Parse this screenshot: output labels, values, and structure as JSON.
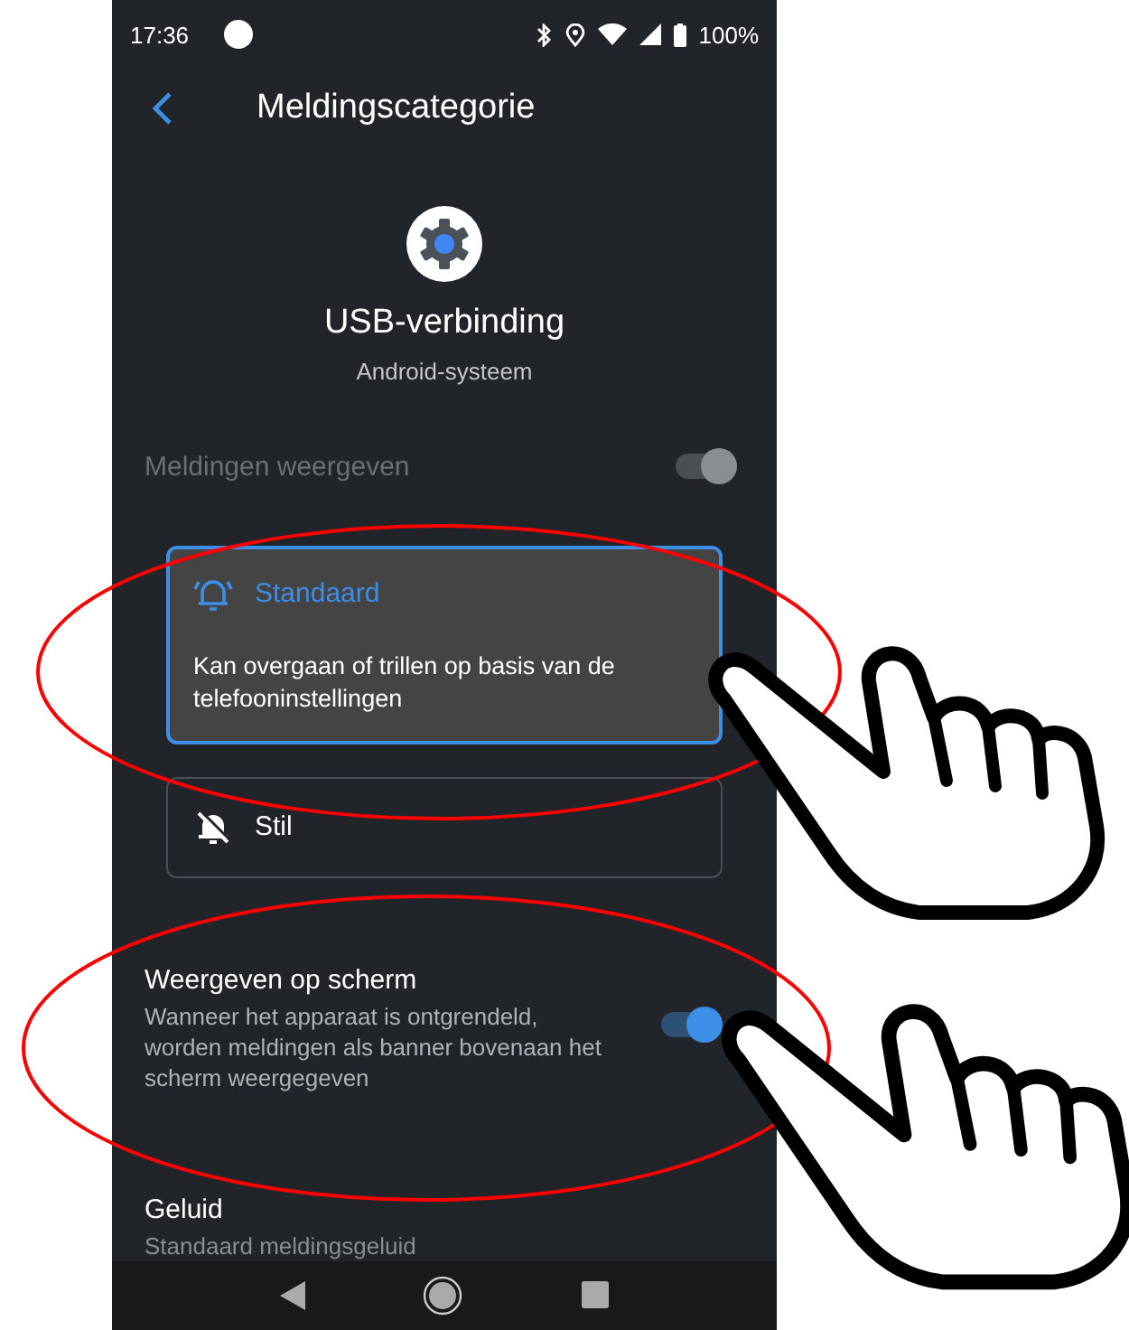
{
  "status_bar": {
    "time": "17:36",
    "battery": "100%"
  },
  "header": {
    "title": "Meldingscategorie"
  },
  "app": {
    "name": "USB-verbinding",
    "subtitle": "Android-systeem"
  },
  "show_notifications": {
    "label": "Meldingen weergeven",
    "on": true,
    "disabled": true
  },
  "behaviors": [
    {
      "kind": "ring",
      "label": "Standaard",
      "description": "Kan overgaan of trillen op basis van de telefooninstellingen",
      "selected": true
    },
    {
      "kind": "silent",
      "label": "Stil",
      "selected": false
    }
  ],
  "settings": [
    {
      "kind": "toggle",
      "label": "Weergeven op scherm",
      "description": "Wanneer het apparaat is ontgrendeld, worden meldingen als banner bovenaan het scherm weergegeven",
      "on": true
    },
    {
      "kind": "text",
      "label": "Geluid",
      "description": "Standaard meldingsgeluid"
    }
  ]
}
